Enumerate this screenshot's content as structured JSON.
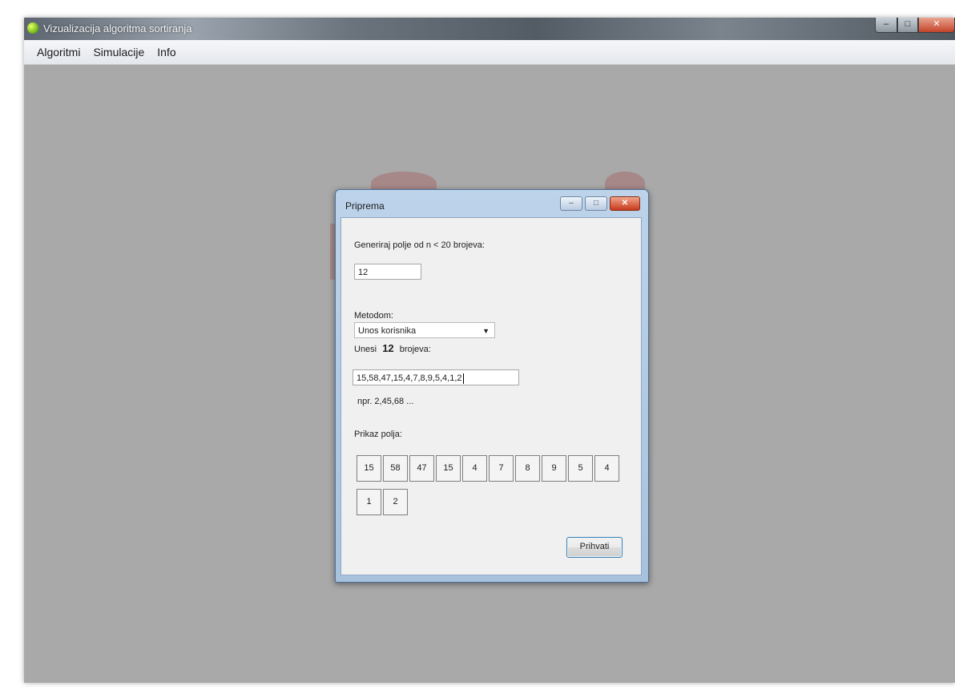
{
  "app": {
    "title": "Vizualizacija algoritma sortiranja",
    "window_controls": {
      "minimize": "–",
      "maximize": "□",
      "close": "✕"
    }
  },
  "menu": {
    "items": [
      "Algoritmi",
      "Simulacije",
      "Info"
    ]
  },
  "dialog": {
    "title": "Priprema",
    "controls": {
      "minimize": "–",
      "maximize": "□",
      "close": "✕"
    },
    "generate_label": "Generiraj polje od n < 20 brojeva:",
    "n_value": "12",
    "method_label": "Metodom:",
    "method_selected": "Unos korisnika",
    "enter_prefix": "Unesi",
    "enter_count": "12",
    "enter_suffix": "brojeva:",
    "numbers_input": "15,58,47,15,4,7,8,9,5,4,1,2",
    "example_hint": "npr. 2,45,68 ...",
    "array_label": "Prikaz polja:",
    "array_cells": [
      "15",
      "58",
      "47",
      "15",
      "4",
      "7",
      "8",
      "9",
      "5",
      "4",
      "1",
      "2"
    ],
    "accept_button": "Prihvati"
  },
  "colors": {
    "workspace": "#a9a9a9",
    "dialog_frame": "#bcd3ea",
    "dialog_body": "#f0f0f0",
    "close_button": "#c8391c"
  }
}
